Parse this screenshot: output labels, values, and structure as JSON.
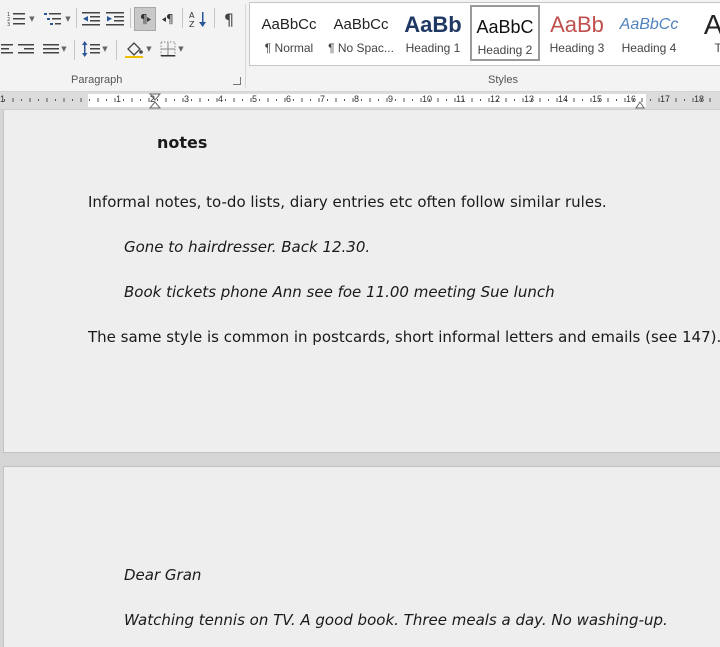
{
  "ribbon": {
    "paragraph_group_label": "Paragraph",
    "styles_group_label": "Styles",
    "buttons": {
      "bullets": "bullets-icon",
      "numbering": "numbering-icon",
      "multilevel": "multilevel-list-icon",
      "decrease_indent": "decrease-indent-icon",
      "increase_indent": "increase-indent-icon",
      "ltr": "left-to-right-icon",
      "rtl": "right-to-left-icon",
      "sort": "sort-icon",
      "show_marks": "pilcrow-icon",
      "align_right": "align-right-icon",
      "justify": "justify-icon",
      "line_spacing": "line-spacing-icon",
      "shading": "shading-icon",
      "borders": "borders-icon"
    },
    "sort_letters": "A Z",
    "pilcrow": "¶"
  },
  "styles": [
    {
      "preview": "AaBbCc",
      "name": "¶ Normal",
      "color": "#222222"
    },
    {
      "preview": "AaBbCc",
      "name": "¶ No Spac...",
      "color": "#222222"
    },
    {
      "preview": "AaBb",
      "name": "Heading 1",
      "color": "#1f3864"
    },
    {
      "preview": "AaBbC",
      "name": "Heading 2",
      "color": "#111111",
      "selected": true
    },
    {
      "preview": "AaBb",
      "name": "Heading 3",
      "color": "#c0504d"
    },
    {
      "preview": "AaBbCc",
      "name": "Heading 4",
      "color": "#4f81bd"
    },
    {
      "preview": "Aa",
      "name": "Tit",
      "color": "#222222"
    }
  ],
  "ruler": {
    "left_numbers": [
      "2",
      "1"
    ],
    "numbers": [
      "1",
      "2",
      "3",
      "4",
      "5",
      "6",
      "7",
      "8",
      "9",
      "10",
      "11",
      "12",
      "13",
      "14",
      "15",
      "16",
      "17",
      "18"
    ]
  },
  "document": {
    "heading": "notes",
    "p1": "Informal notes, to-do lists, diary entries etc often follow similar rules.",
    "ex1": "Gone to hairdresser. Back 12.30.",
    "ex2": "Book tickets phone Ann see foe 11.00 meeting Sue lunch",
    "p2": "The same style is common in postcards, short informal letters and emails (see 147).",
    "ex3": "Dear Gran",
    "ex4": "Watching tennis on TV. A good book. Three meals a day. No washing-up."
  }
}
